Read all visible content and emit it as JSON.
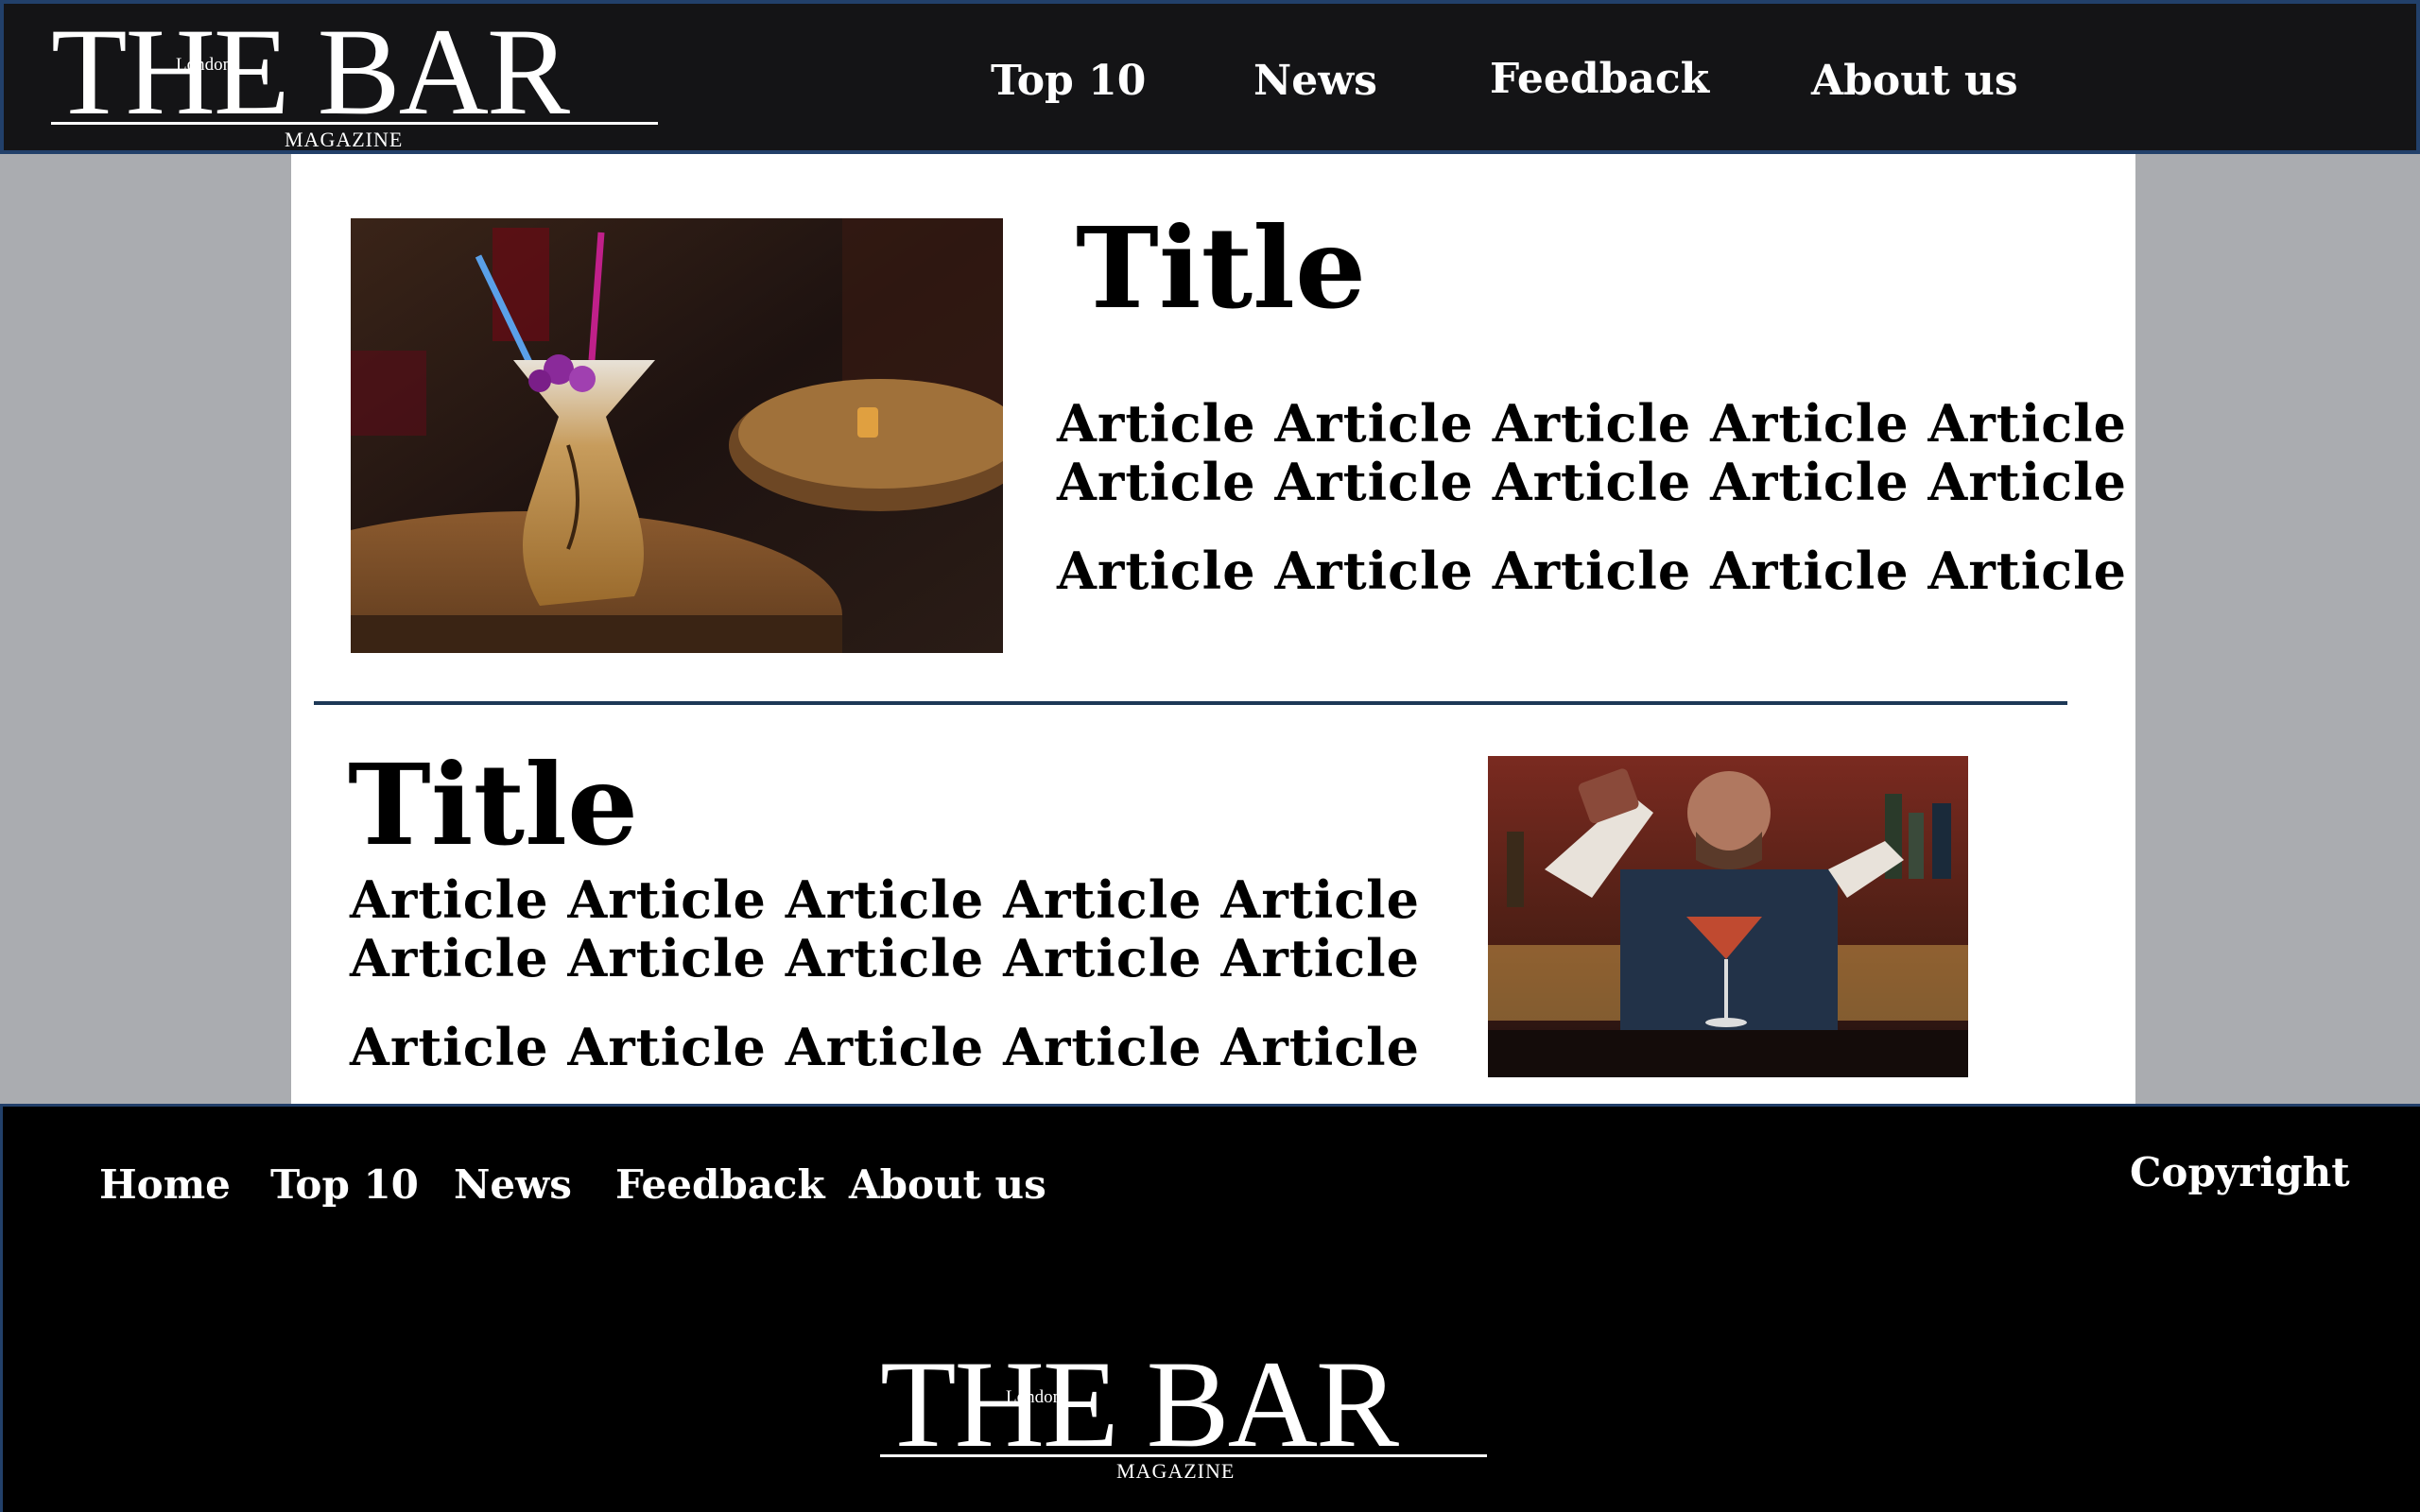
{
  "header": {
    "logo": {
      "main": "THE BAR",
      "city": "London",
      "sub": "MAGAZINE"
    },
    "nav": [
      "Top 10",
      "News",
      "Feedback",
      "About us"
    ]
  },
  "articles": [
    {
      "title": "Title",
      "lines": [
        "Article Article Article Article Article",
        "Article Article Article Article Article",
        "Article Article Article Article Article"
      ]
    },
    {
      "title": "Title",
      "lines": [
        "Article Article Article Article Article",
        "Article Article Article Article Article",
        "Article Article Article Article Article"
      ]
    }
  ],
  "footer": {
    "nav": [
      "Home",
      "Top 10",
      "News",
      "Feedback",
      "About us"
    ],
    "copyright": "Copyright",
    "logo": {
      "main": "THE BAR",
      "city": "London",
      "sub": "MAGAZINE"
    }
  },
  "colors": {
    "header_bg": "#141416",
    "accent_border": "#22406a",
    "page_bg": "#aaacb0",
    "divider": "#1d3856"
  }
}
